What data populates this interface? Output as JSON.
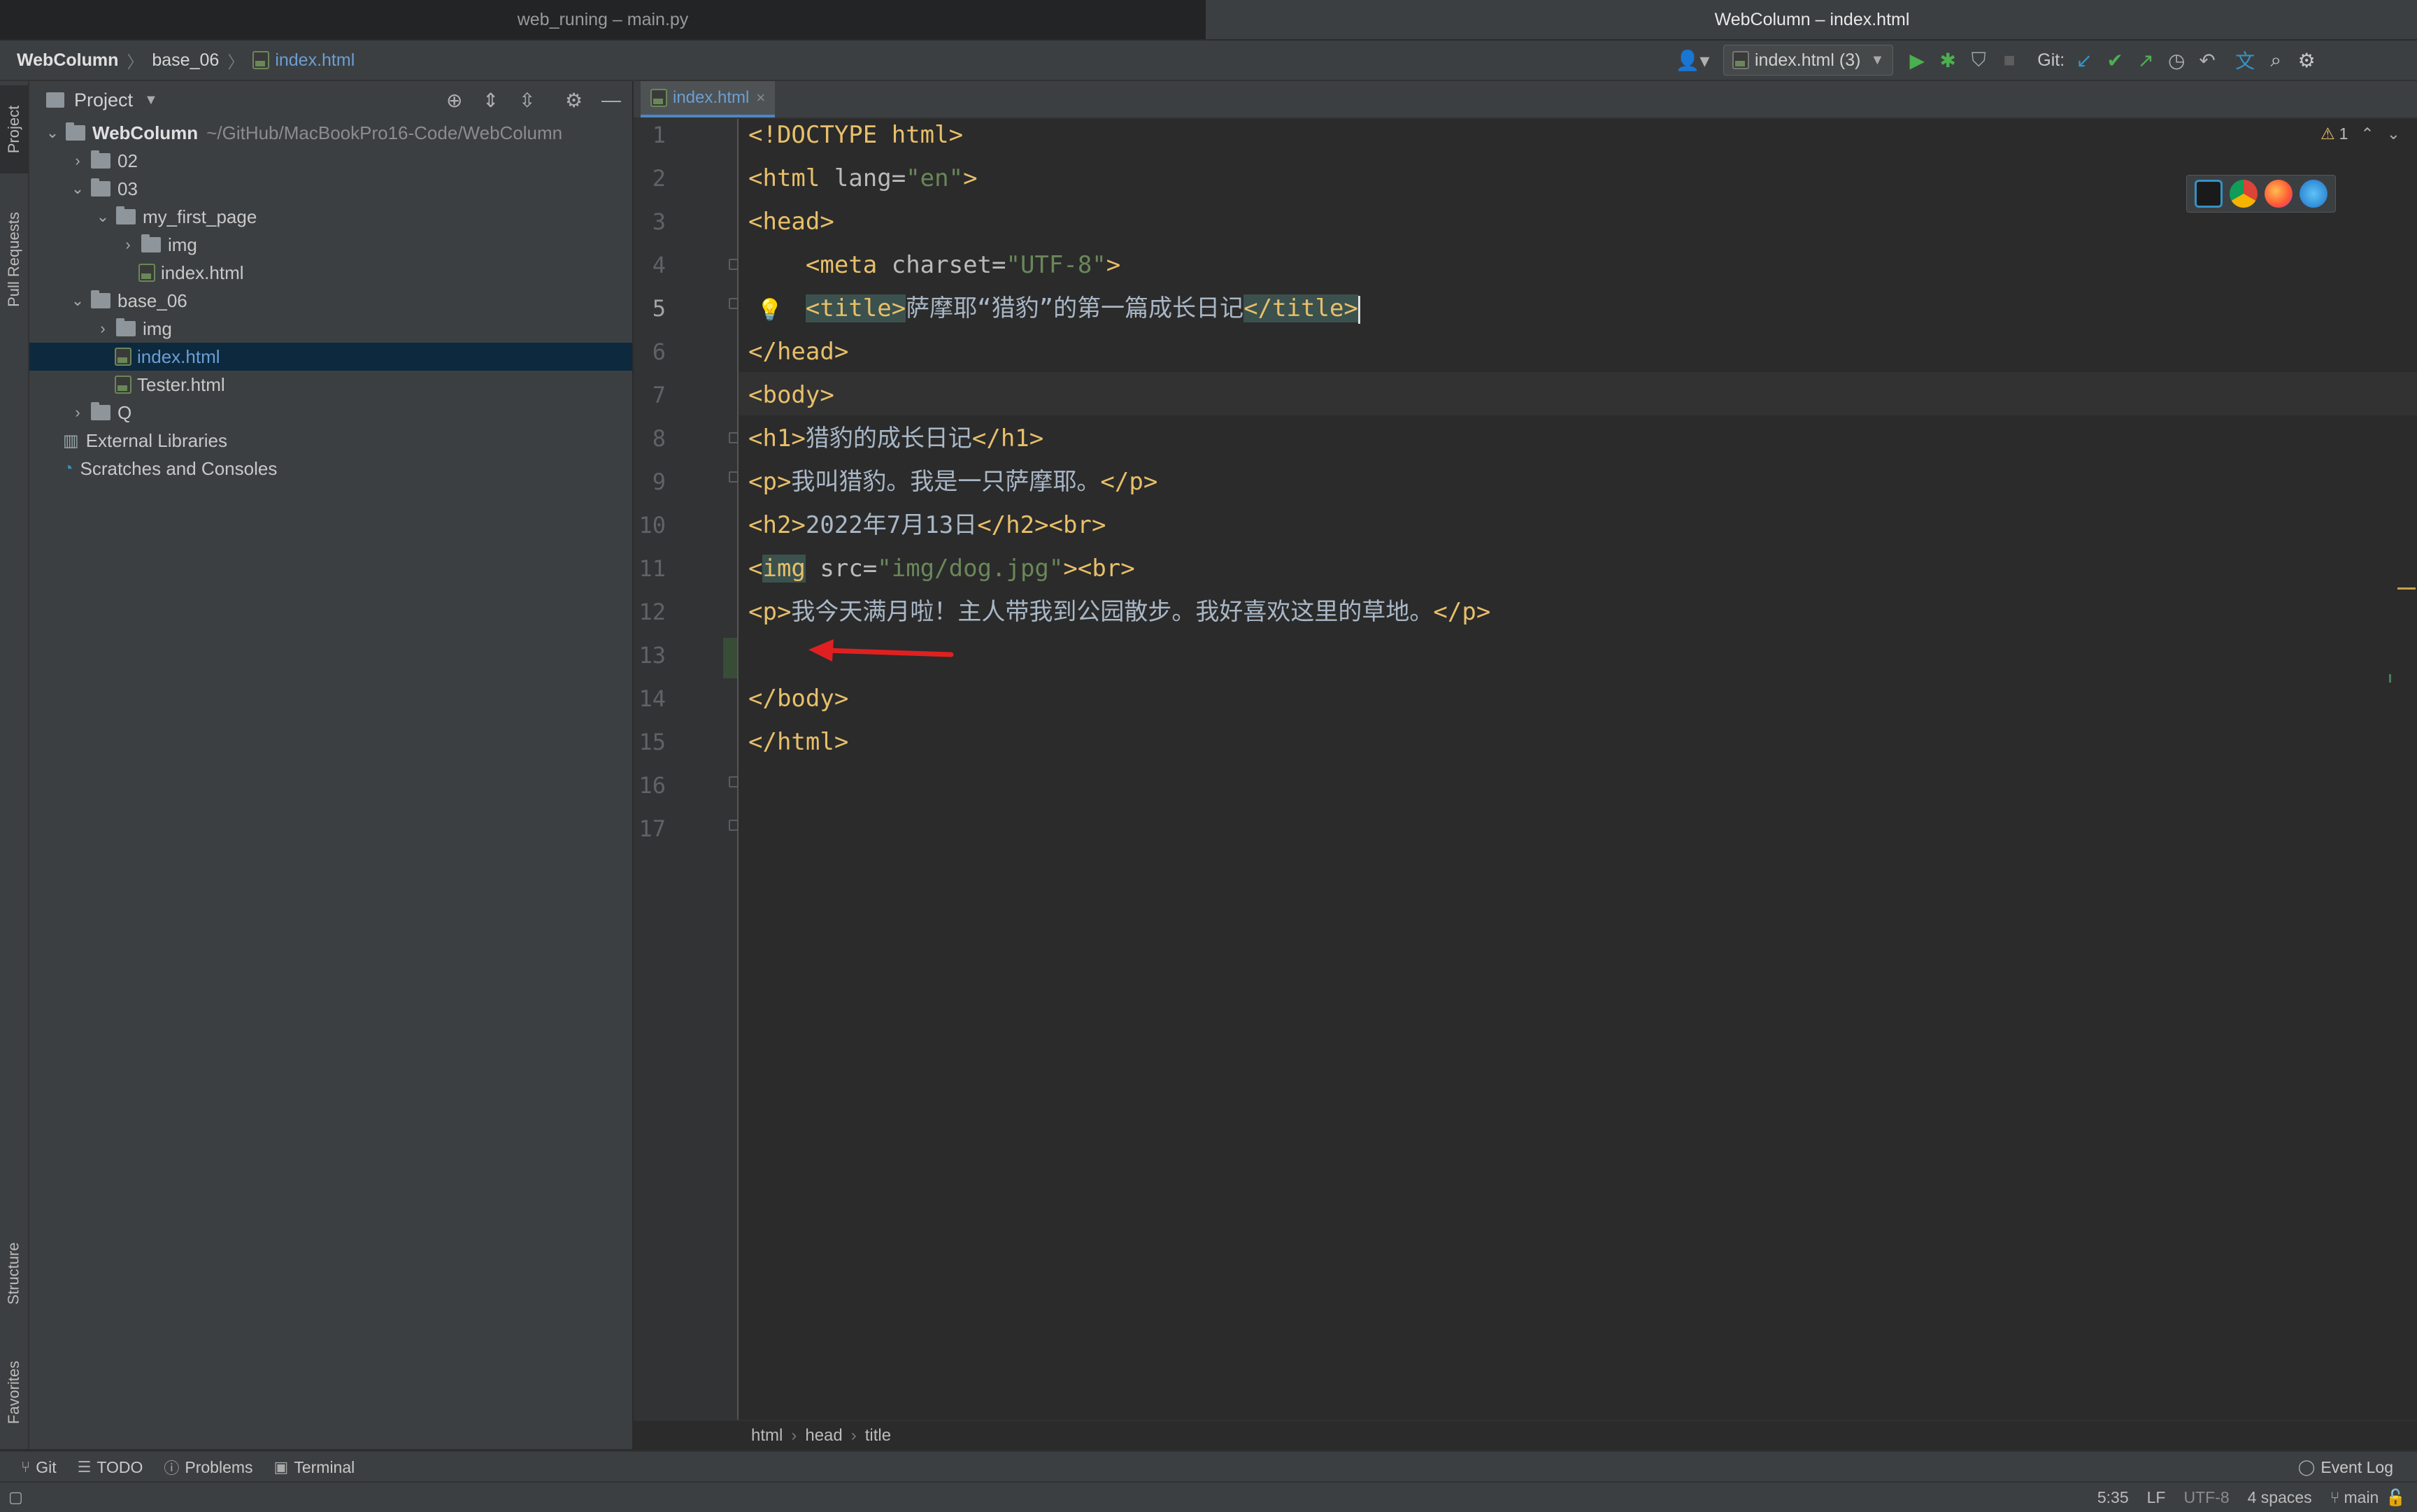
{
  "window_tabs": {
    "left": "web_runing – main.py",
    "right": "WebColumn – index.html"
  },
  "breadcrumb": {
    "project": "WebColumn",
    "folder": "base_06",
    "file": "index.html"
  },
  "toolbar": {
    "run_config": "index.html (3)",
    "git_label": "Git:"
  },
  "left_stripe": {
    "project": "Project",
    "pull_requests": "Pull Requests",
    "structure": "Structure",
    "favorites": "Favorites"
  },
  "project_panel": {
    "title": "Project",
    "root_name": "WebColumn",
    "root_path": "~/GitHub/MacBookPro16-Code/WebColumn",
    "items": [
      {
        "label": "02"
      },
      {
        "label": "03"
      },
      {
        "label": "my_first_page"
      },
      {
        "label": "img"
      },
      {
        "label": "index.html"
      },
      {
        "label": "base_06"
      },
      {
        "label": "img"
      },
      {
        "label": "index.html"
      },
      {
        "label": "Tester.html"
      },
      {
        "label": "Q"
      },
      {
        "label": "External Libraries"
      },
      {
        "label": "Scratches and Consoles"
      }
    ]
  },
  "editor": {
    "tab_label": "index.html",
    "warnings": "1",
    "line_numbers": [
      "1",
      "2",
      "3",
      "4",
      "5",
      "6",
      "7",
      "8",
      "9",
      "10",
      "11",
      "12",
      "13",
      "14",
      "15",
      "16",
      "17"
    ],
    "lines": [
      [
        {
          "t": "<!DOCTYPE html>"
        }
      ],
      [
        {
          "t": "<html "
        },
        {
          "a": "lang="
        },
        {
          "s": "\"en\""
        },
        {
          "t": ">"
        }
      ],
      [
        {
          "t": "<head>"
        }
      ],
      [
        {
          "p": "    "
        },
        {
          "t": "<meta "
        },
        {
          "a": "charset="
        },
        {
          "s": "\"UTF-8\""
        },
        {
          "t": ">"
        }
      ],
      [
        {
          "p": "    "
        },
        {
          "h": "<title>"
        },
        {
          "x": "萨摩耶“猎豹”的第一篇成长日记"
        },
        {
          "h": "</title>"
        }
      ],
      [
        {
          "t": "</head>"
        }
      ],
      [
        {
          "t": "<body>"
        }
      ],
      [
        {
          "t": "<h1>"
        },
        {
          "x": "猎豹的成长日记"
        },
        {
          "t": "</h1>"
        }
      ],
      [
        {
          "t": "<p>"
        },
        {
          "x": "我叫猎豹。我是一只萨摩耶。"
        },
        {
          "t": "</p>"
        }
      ],
      [
        {
          "t": "<h2>"
        },
        {
          "x": "2022年7月13日"
        },
        {
          "t": "</h2><br>"
        }
      ],
      [
        {
          "t": "<"
        },
        {
          "h": "img"
        },
        {
          "a": " src="
        },
        {
          "s": "\"img/dog.jpg\""
        },
        {
          "t": "><br>"
        }
      ],
      [
        {
          "t": "<p>"
        },
        {
          "x": "我今天满月啦！主人带我到公园散步。我好喜欢这里的草地。"
        },
        {
          "t": "</p>"
        }
      ],
      [],
      [
        {
          "t": "</body>"
        }
      ],
      [
        {
          "t": "</html>"
        }
      ],
      [],
      []
    ],
    "breadcrumbs": [
      "html",
      "head",
      "title"
    ]
  },
  "bottom_tools": {
    "git": "Git",
    "todo": "TODO",
    "problems": "Problems",
    "terminal": "Terminal",
    "event_log": "Event Log"
  },
  "status_bar": {
    "position": "5:35",
    "line_sep": "LF",
    "encoding": "UTF-8",
    "indent": "4 spaces",
    "branch": "main"
  },
  "colors": {
    "tag": "#e8bf6a",
    "string": "#6a8759",
    "attr": "#bababa",
    "text": "#a9b7c6",
    "selection": "#0d293e",
    "accent": "#4a88c7",
    "arrow": "#e02020"
  }
}
